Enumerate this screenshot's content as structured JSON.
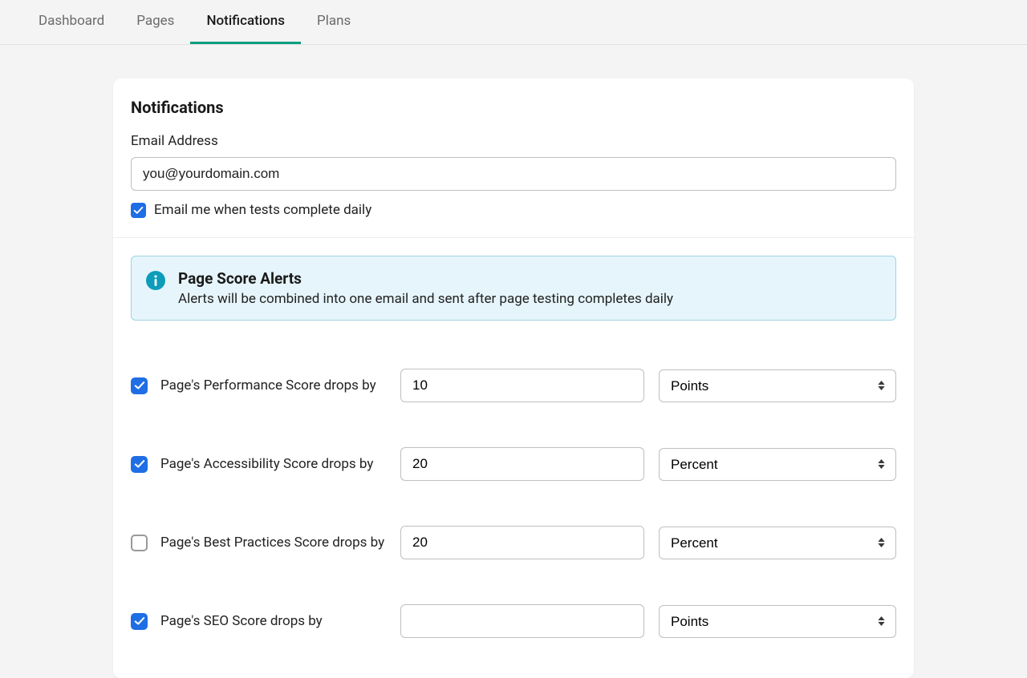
{
  "tabs": [
    "Dashboard",
    "Pages",
    "Notifications",
    "Plans"
  ],
  "activeTab": 2,
  "card": {
    "title": "Notifications",
    "emailLabel": "Email Address",
    "emailPlaceholder": "you@yourdomain.com",
    "dailyCheckbox": {
      "checked": true,
      "label": "Email me when tests complete daily"
    }
  },
  "banner": {
    "title": "Page Score Alerts",
    "subtitle": "Alerts will be combined into one email and sent after page testing completes daily"
  },
  "selectOptions": [
    "Points",
    "Percent"
  ],
  "alerts": [
    {
      "checked": true,
      "label": "Page's Performance Score drops by",
      "value": "10",
      "unit": "Points"
    },
    {
      "checked": true,
      "label": "Page's Accessibility Score drops by",
      "value": "20",
      "unit": "Percent"
    },
    {
      "checked": false,
      "label": "Page's Best Practices Score drops by",
      "value": "20",
      "unit": "Percent"
    },
    {
      "checked": true,
      "label": "Page's SEO Score drops by",
      "value": "",
      "unit": ""
    }
  ]
}
